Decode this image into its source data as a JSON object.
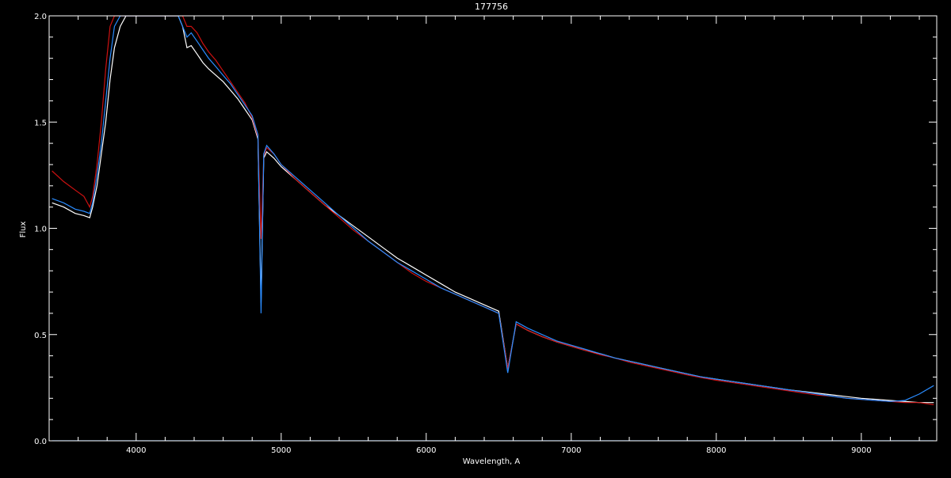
{
  "chart_data": {
    "type": "line",
    "title": "177756",
    "xlabel": "Wavelength, A",
    "ylabel": "Flux",
    "xlim": [
      3400,
      9520
    ],
    "ylim": [
      0.0,
      2.0
    ],
    "x_ticks": [
      4000,
      5000,
      6000,
      7000,
      8000,
      9000
    ],
    "x_tick_labels": [
      "4000",
      "5000",
      "6000",
      "7000",
      "8000",
      "9000"
    ],
    "y_ticks": [
      0.0,
      0.5,
      1.0,
      1.5,
      2.0
    ],
    "y_tick_labels": [
      "0.0",
      "0.5",
      "1.0",
      "1.5",
      "2.0"
    ],
    "grid": false,
    "legend": "none",
    "colors": {
      "background": "#000000",
      "axes": "#ffffff"
    },
    "series": [
      {
        "color": "#ffffff",
        "x": [
          3420,
          3500,
          3580,
          3640,
          3680,
          3700,
          3730,
          3760,
          3790,
          3820,
          3850,
          3890,
          3930,
          3970,
          4010,
          4050,
          4100,
          4150,
          4200,
          4250,
          4290,
          4320,
          4350,
          4380,
          4420,
          4460,
          4500,
          4550,
          4600,
          4650,
          4700,
          4750,
          4800,
          4840,
          4861,
          4880,
          4900,
          4950,
          5000,
          5100,
          5200,
          5300,
          5400,
          5500,
          5600,
          5700,
          5800,
          5900,
          6000,
          6100,
          6200,
          6300,
          6400,
          6500,
          6562,
          6620,
          6700,
          6800,
          6900,
          7000,
          7100,
          7200,
          7300,
          7400,
          7500,
          7600,
          7700,
          7800,
          7900,
          8000,
          8100,
          8200,
          8300,
          8400,
          8500,
          8600,
          8700,
          8800,
          8900,
          9000,
          9100,
          9200,
          9300,
          9400,
          9500
        ],
        "y": [
          1.12,
          1.1,
          1.07,
          1.06,
          1.05,
          1.1,
          1.2,
          1.35,
          1.5,
          1.7,
          1.85,
          1.95,
          2.0,
          2.0,
          2.0,
          2.0,
          2.0,
          2.0,
          2.0,
          2.0,
          2.0,
          1.95,
          1.85,
          1.86,
          1.82,
          1.78,
          1.75,
          1.72,
          1.69,
          1.65,
          1.61,
          1.56,
          1.51,
          1.42,
          0.65,
          1.33,
          1.36,
          1.33,
          1.29,
          1.23,
          1.17,
          1.11,
          1.06,
          1.01,
          0.96,
          0.91,
          0.86,
          0.82,
          0.78,
          0.74,
          0.7,
          0.67,
          0.64,
          0.61,
          0.34,
          0.55,
          0.52,
          0.49,
          0.465,
          0.445,
          0.425,
          0.41,
          0.39,
          0.375,
          0.36,
          0.345,
          0.33,
          0.315,
          0.3,
          0.29,
          0.28,
          0.27,
          0.26,
          0.25,
          0.24,
          0.232,
          0.224,
          0.216,
          0.208,
          0.2,
          0.195,
          0.19,
          0.185,
          0.18,
          0.18
        ]
      },
      {
        "color": "#cc1111",
        "x": [
          3420,
          3500,
          3580,
          3640,
          3680,
          3700,
          3730,
          3760,
          3790,
          3820,
          3850,
          3890,
          3930,
          3970,
          4010,
          4050,
          4100,
          4150,
          4200,
          4250,
          4290,
          4320,
          4350,
          4380,
          4420,
          4460,
          4500,
          4550,
          4600,
          4650,
          4700,
          4750,
          4800,
          4840,
          4861,
          4880,
          4900,
          4950,
          5000,
          5100,
          5200,
          5300,
          5400,
          5500,
          5600,
          5700,
          5800,
          5900,
          6000,
          6100,
          6200,
          6300,
          6400,
          6500,
          6562,
          6620,
          6700,
          6800,
          6900,
          7000,
          7100,
          7200,
          7300,
          7400,
          7500,
          7600,
          7700,
          7800,
          7900,
          8000,
          8100,
          8200,
          8300,
          8400,
          8500,
          8600,
          8700,
          8800,
          8900,
          9000,
          9100,
          9200,
          9300,
          9400,
          9500
        ],
        "y": [
          1.27,
          1.22,
          1.18,
          1.15,
          1.1,
          1.15,
          1.3,
          1.5,
          1.75,
          1.95,
          2.0,
          2.0,
          2.0,
          2.0,
          2.0,
          2.0,
          2.0,
          2.0,
          2.0,
          2.0,
          2.0,
          2.0,
          1.95,
          1.95,
          1.92,
          1.87,
          1.83,
          1.79,
          1.74,
          1.69,
          1.64,
          1.59,
          1.52,
          1.43,
          0.95,
          1.34,
          1.38,
          1.35,
          1.3,
          1.23,
          1.17,
          1.11,
          1.05,
          0.99,
          0.94,
          0.89,
          0.84,
          0.79,
          0.75,
          0.72,
          0.69,
          0.66,
          0.63,
          0.6,
          0.34,
          0.55,
          0.52,
          0.49,
          0.465,
          0.445,
          0.425,
          0.405,
          0.39,
          0.37,
          0.355,
          0.34,
          0.325,
          0.31,
          0.297,
          0.285,
          0.275,
          0.265,
          0.255,
          0.245,
          0.235,
          0.225,
          0.215,
          0.21,
          0.2,
          0.195,
          0.19,
          0.185,
          0.18,
          0.18,
          0.17
        ]
      },
      {
        "color": "#2a8cff",
        "x": [
          3420,
          3500,
          3580,
          3640,
          3680,
          3700,
          3730,
          3760,
          3790,
          3820,
          3850,
          3890,
          3930,
          3970,
          4010,
          4050,
          4100,
          4150,
          4200,
          4250,
          4290,
          4320,
          4350,
          4380,
          4420,
          4460,
          4500,
          4550,
          4600,
          4650,
          4700,
          4750,
          4800,
          4840,
          4861,
          4880,
          4900,
          4950,
          5000,
          5100,
          5200,
          5300,
          5400,
          5500,
          5600,
          5700,
          5800,
          5900,
          6000,
          6100,
          6200,
          6300,
          6400,
          6500,
          6562,
          6620,
          6700,
          6800,
          6900,
          7000,
          7100,
          7200,
          7300,
          7400,
          7500,
          7600,
          7700,
          7800,
          7900,
          8000,
          8100,
          8200,
          8300,
          8400,
          8500,
          8600,
          8700,
          8800,
          8900,
          9000,
          9100,
          9200,
          9300,
          9400,
          9500
        ],
        "y": [
          1.14,
          1.12,
          1.09,
          1.08,
          1.07,
          1.12,
          1.25,
          1.4,
          1.6,
          1.8,
          1.95,
          2.0,
          2.0,
          2.0,
          2.0,
          2.0,
          2.0,
          2.0,
          2.0,
          2.0,
          2.0,
          1.95,
          1.9,
          1.92,
          1.88,
          1.84,
          1.8,
          1.76,
          1.72,
          1.68,
          1.63,
          1.58,
          1.53,
          1.44,
          0.6,
          1.35,
          1.39,
          1.35,
          1.3,
          1.24,
          1.18,
          1.12,
          1.06,
          1.0,
          0.94,
          0.89,
          0.84,
          0.8,
          0.76,
          0.72,
          0.69,
          0.66,
          0.63,
          0.6,
          0.32,
          0.56,
          0.53,
          0.5,
          0.47,
          0.45,
          0.43,
          0.41,
          0.39,
          0.375,
          0.36,
          0.345,
          0.33,
          0.315,
          0.3,
          0.29,
          0.28,
          0.27,
          0.26,
          0.25,
          0.24,
          0.23,
          0.22,
          0.21,
          0.2,
          0.195,
          0.19,
          0.185,
          0.19,
          0.22,
          0.26
        ]
      },
      {
        "color": "#2a8cff",
        "x": [
          3420,
          9500
        ],
        "y": [
          0.0,
          0.0
        ]
      }
    ]
  }
}
